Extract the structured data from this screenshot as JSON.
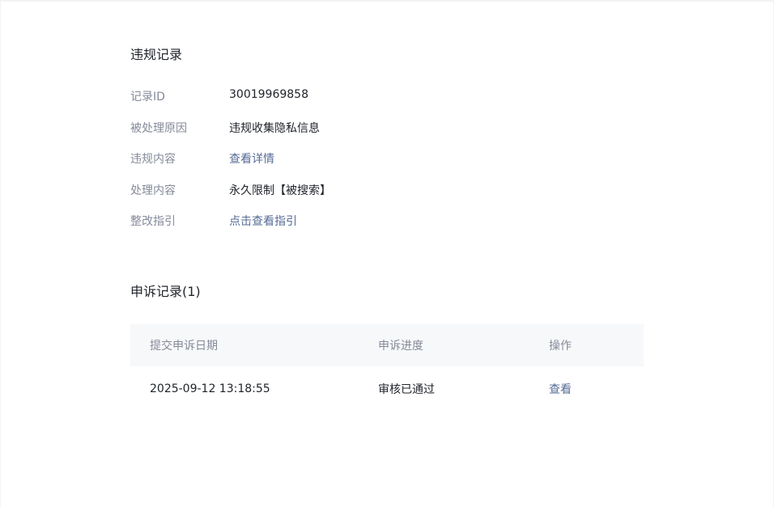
{
  "violation": {
    "title": "违规记录",
    "fields": [
      {
        "label": "记录ID",
        "value": "30019969858"
      },
      {
        "label": "被处理原因",
        "value": "违规收集隐私信息"
      },
      {
        "label": "违规内容",
        "value": "查看详情"
      },
      {
        "label": "处理内容",
        "value": "永久限制【被搜索】"
      },
      {
        "label": "整改指引",
        "value": "点击查看指引"
      }
    ]
  },
  "appeal": {
    "title": "申诉记录(1)",
    "columns": [
      "提交申诉日期",
      "申诉进度",
      "操作"
    ],
    "rows": [
      {
        "date": "2025-09-12 13:18:55",
        "progress": "审核已通过",
        "action": "查看"
      }
    ]
  },
  "colors": {
    "link": "#576b95",
    "label": "#858a99",
    "text": "#1f2329",
    "table_header_bg": "#f7f8fa"
  }
}
